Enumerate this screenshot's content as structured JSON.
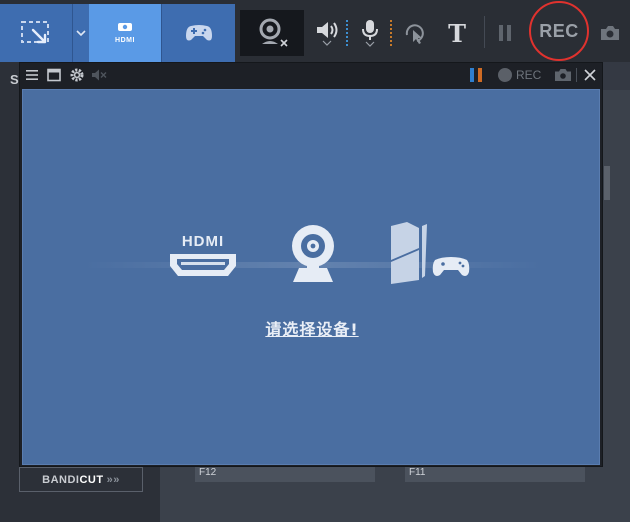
{
  "toolbar": {
    "modes": [
      {
        "name": "screen",
        "icon": "screen-region-icon"
      },
      {
        "name": "device",
        "icon": "hdmi-icon",
        "label": "HDMI"
      },
      {
        "name": "game",
        "icon": "gamepad-icon"
      }
    ],
    "text_glyph": "T",
    "rec_label": "REC",
    "rec_accent": "#e0322e"
  },
  "background": {
    "side_letter": "S",
    "card1_label": "F12",
    "card2_label": "F11",
    "bandicut": {
      "part1": "BANDI",
      "part2": "CUT",
      "arrows": "»»"
    }
  },
  "recorder": {
    "rec_label": "REC",
    "hdmi_label": "HDMI",
    "select_device": "请选择设备!",
    "content_color": "#4a6ea1"
  }
}
